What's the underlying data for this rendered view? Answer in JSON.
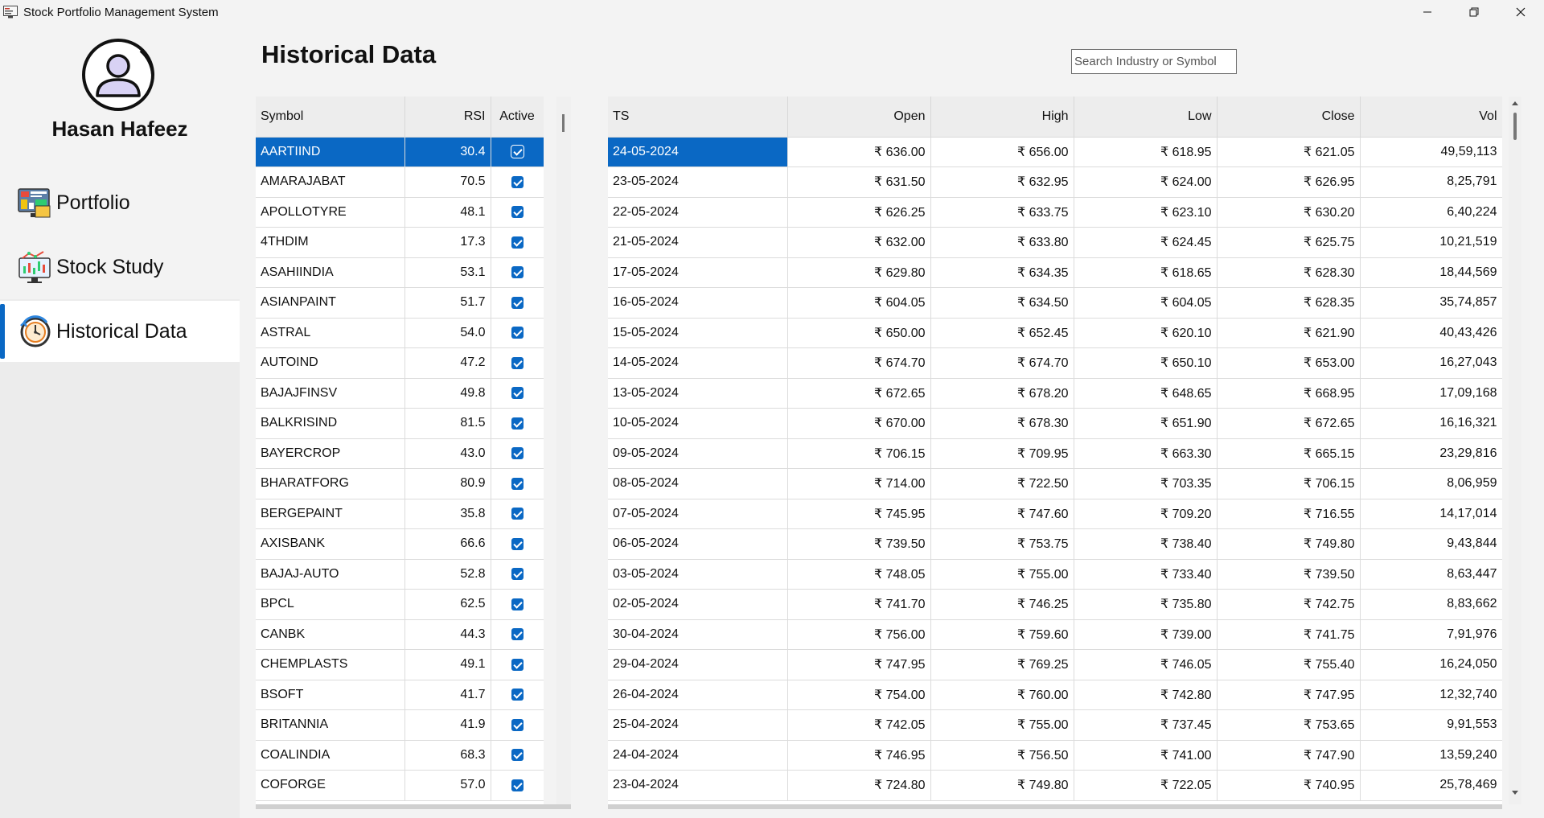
{
  "window": {
    "title": "Stock Portfolio Management System"
  },
  "sidebar": {
    "user_name": "Hasan Hafeez",
    "items": [
      {
        "label": "Portfolio",
        "icon": "portfolio-dashboard-icon"
      },
      {
        "label": "Stock Study",
        "icon": "stock-chart-icon"
      },
      {
        "label": "Historical Data",
        "icon": "history-clock-icon"
      }
    ],
    "active_item": "Historical Data"
  },
  "page": {
    "title": "Historical Data"
  },
  "search": {
    "placeholder": "Search Industry or Symbol"
  },
  "accent_color": "#0a68c4",
  "symbols_table": {
    "headers": {
      "symbol": "Symbol",
      "rsi": "RSI",
      "active": "Active"
    },
    "selected_symbol": "AARTIIND",
    "rows": [
      {
        "symbol": "AARTIIND",
        "rsi": "30.4",
        "active": true
      },
      {
        "symbol": "AMARAJABAT",
        "rsi": "70.5",
        "active": true
      },
      {
        "symbol": "APOLLOTYRE",
        "rsi": "48.1",
        "active": true
      },
      {
        "symbol": "4THDIM",
        "rsi": "17.3",
        "active": true
      },
      {
        "symbol": "ASAHIINDIA",
        "rsi": "53.1",
        "active": true
      },
      {
        "symbol": "ASIANPAINT",
        "rsi": "51.7",
        "active": true
      },
      {
        "symbol": "ASTRAL",
        "rsi": "54.0",
        "active": true
      },
      {
        "symbol": "AUTOIND",
        "rsi": "47.2",
        "active": true
      },
      {
        "symbol": "BAJAJFINSV",
        "rsi": "49.8",
        "active": true
      },
      {
        "symbol": "BALKRISIND",
        "rsi": "81.5",
        "active": true
      },
      {
        "symbol": "BAYERCROP",
        "rsi": "43.0",
        "active": true
      },
      {
        "symbol": "BHARATFORG",
        "rsi": "80.9",
        "active": true
      },
      {
        "symbol": "BERGEPAINT",
        "rsi": "35.8",
        "active": true
      },
      {
        "symbol": "AXISBANK",
        "rsi": "66.6",
        "active": true
      },
      {
        "symbol": "BAJAJ-AUTO",
        "rsi": "52.8",
        "active": true
      },
      {
        "symbol": "BPCL",
        "rsi": "62.5",
        "active": true
      },
      {
        "symbol": "CANBK",
        "rsi": "44.3",
        "active": true
      },
      {
        "symbol": "CHEMPLASTS",
        "rsi": "49.1",
        "active": true
      },
      {
        "symbol": "BSOFT",
        "rsi": "41.7",
        "active": true
      },
      {
        "symbol": "BRITANNIA",
        "rsi": "41.9",
        "active": true
      },
      {
        "symbol": "COALINDIA",
        "rsi": "68.3",
        "active": true
      },
      {
        "symbol": "COFORGE",
        "rsi": "57.0",
        "active": true
      }
    ]
  },
  "history_table": {
    "headers": {
      "ts": "TS",
      "open": "Open",
      "high": "High",
      "low": "Low",
      "close": "Close",
      "vol": "Vol"
    },
    "rows": [
      {
        "ts": "24-05-2024",
        "open": "₹ 636.00",
        "high": "₹ 656.00",
        "low": "₹ 618.95",
        "close": "₹ 621.05",
        "vol": "49,59,113"
      },
      {
        "ts": "23-05-2024",
        "open": "₹ 631.50",
        "high": "₹ 632.95",
        "low": "₹ 624.00",
        "close": "₹ 626.95",
        "vol": "8,25,791"
      },
      {
        "ts": "22-05-2024",
        "open": "₹ 626.25",
        "high": "₹ 633.75",
        "low": "₹ 623.10",
        "close": "₹ 630.20",
        "vol": "6,40,224"
      },
      {
        "ts": "21-05-2024",
        "open": "₹ 632.00",
        "high": "₹ 633.80",
        "low": "₹ 624.45",
        "close": "₹ 625.75",
        "vol": "10,21,519"
      },
      {
        "ts": "17-05-2024",
        "open": "₹ 629.80",
        "high": "₹ 634.35",
        "low": "₹ 618.65",
        "close": "₹ 628.30",
        "vol": "18,44,569"
      },
      {
        "ts": "16-05-2024",
        "open": "₹ 604.05",
        "high": "₹ 634.50",
        "low": "₹ 604.05",
        "close": "₹ 628.35",
        "vol": "35,74,857"
      },
      {
        "ts": "15-05-2024",
        "open": "₹ 650.00",
        "high": "₹ 652.45",
        "low": "₹ 620.10",
        "close": "₹ 621.90",
        "vol": "40,43,426"
      },
      {
        "ts": "14-05-2024",
        "open": "₹ 674.70",
        "high": "₹ 674.70",
        "low": "₹ 650.10",
        "close": "₹ 653.00",
        "vol": "16,27,043"
      },
      {
        "ts": "13-05-2024",
        "open": "₹ 672.65",
        "high": "₹ 678.20",
        "low": "₹ 648.65",
        "close": "₹ 668.95",
        "vol": "17,09,168"
      },
      {
        "ts": "10-05-2024",
        "open": "₹ 670.00",
        "high": "₹ 678.30",
        "low": "₹ 651.90",
        "close": "₹ 672.65",
        "vol": "16,16,321"
      },
      {
        "ts": "09-05-2024",
        "open": "₹ 706.15",
        "high": "₹ 709.95",
        "low": "₹ 663.30",
        "close": "₹ 665.15",
        "vol": "23,29,816"
      },
      {
        "ts": "08-05-2024",
        "open": "₹ 714.00",
        "high": "₹ 722.50",
        "low": "₹ 703.35",
        "close": "₹ 706.15",
        "vol": "8,06,959"
      },
      {
        "ts": "07-05-2024",
        "open": "₹ 745.95",
        "high": "₹ 747.60",
        "low": "₹ 709.20",
        "close": "₹ 716.55",
        "vol": "14,17,014"
      },
      {
        "ts": "06-05-2024",
        "open": "₹ 739.50",
        "high": "₹ 753.75",
        "low": "₹ 738.40",
        "close": "₹ 749.80",
        "vol": "9,43,844"
      },
      {
        "ts": "03-05-2024",
        "open": "₹ 748.05",
        "high": "₹ 755.00",
        "low": "₹ 733.40",
        "close": "₹ 739.50",
        "vol": "8,63,447"
      },
      {
        "ts": "02-05-2024",
        "open": "₹ 741.70",
        "high": "₹ 746.25",
        "low": "₹ 735.80",
        "close": "₹ 742.75",
        "vol": "8,83,662"
      },
      {
        "ts": "30-04-2024",
        "open": "₹ 756.00",
        "high": "₹ 759.60",
        "low": "₹ 739.00",
        "close": "₹ 741.75",
        "vol": "7,91,976"
      },
      {
        "ts": "29-04-2024",
        "open": "₹ 747.95",
        "high": "₹ 769.25",
        "low": "₹ 746.05",
        "close": "₹ 755.40",
        "vol": "16,24,050"
      },
      {
        "ts": "26-04-2024",
        "open": "₹ 754.00",
        "high": "₹ 760.00",
        "low": "₹ 742.80",
        "close": "₹ 747.95",
        "vol": "12,32,740"
      },
      {
        "ts": "25-04-2024",
        "open": "₹ 742.05",
        "high": "₹ 755.00",
        "low": "₹ 737.45",
        "close": "₹ 753.65",
        "vol": "9,91,553"
      },
      {
        "ts": "24-04-2024",
        "open": "₹ 746.95",
        "high": "₹ 756.50",
        "low": "₹ 741.00",
        "close": "₹ 747.90",
        "vol": "13,59,240"
      },
      {
        "ts": "23-04-2024",
        "open": "₹ 724.80",
        "high": "₹ 749.80",
        "low": "₹ 722.05",
        "close": "₹ 740.95",
        "vol": "25,78,469"
      }
    ]
  }
}
